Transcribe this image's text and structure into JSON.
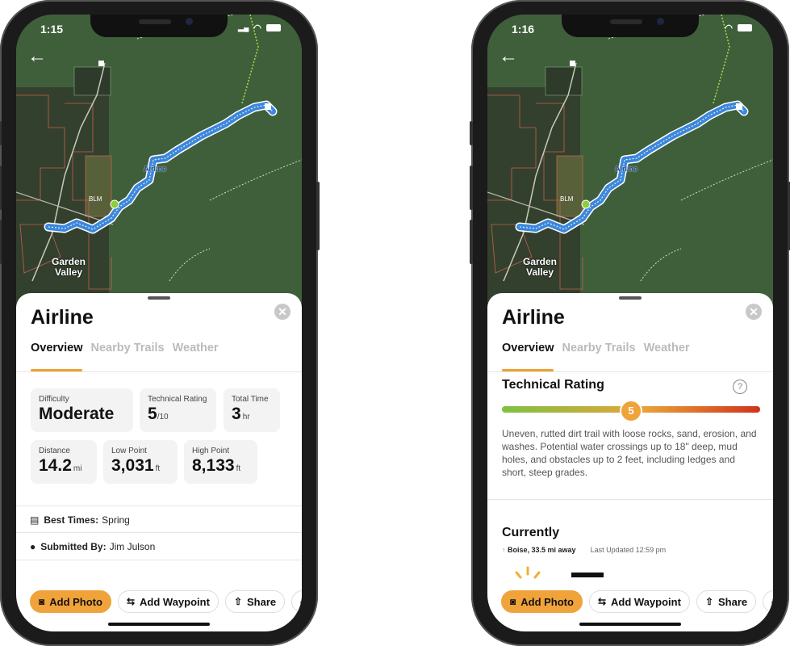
{
  "phones": [
    {
      "status_time": "1:15",
      "trail_name": "Airline",
      "map_labels": {
        "trail": "Airline",
        "area": "BLM",
        "town_line1": "Garden",
        "town_line2": "Valley"
      },
      "tabs": [
        {
          "label": "Overview",
          "active": true
        },
        {
          "label": "Nearby Trails"
        },
        {
          "label": "Weather"
        }
      ],
      "stats": [
        {
          "label": "Difficulty",
          "value": "Moderate",
          "unit": ""
        },
        {
          "label": "Technical Rating",
          "value": "5",
          "unit": "/10"
        },
        {
          "label": "Total Time",
          "value": "3",
          "unit": "hr"
        },
        {
          "label": "Distance",
          "value": "14.2",
          "unit": "mi"
        },
        {
          "label": "Low Point",
          "value": "3,031",
          "unit": "ft"
        },
        {
          "label": "High Point",
          "value": "8,133",
          "unit": "ft"
        }
      ],
      "best_times": {
        "label": "Best Times:",
        "value": "Spring"
      },
      "submitted_by": {
        "label": "Submitted By:",
        "value": "Jim Julson"
      }
    },
    {
      "status_time": "1:16",
      "trail_name": "Airline",
      "map_labels": {
        "trail": "Airline",
        "area": "BLM",
        "town_line1": "Garden",
        "town_line2": "Valley"
      },
      "tabs": [
        {
          "label": "Overview",
          "active": true
        },
        {
          "label": "Nearby Trails"
        },
        {
          "label": "Weather"
        }
      ],
      "technical_rating": {
        "title": "Technical Rating",
        "value": 5,
        "max": 10,
        "description": "Uneven, rutted dirt trail with loose rocks, sand, erosion, and washes. Potential water crossings up to 18\" deep, mud holes, and obstacles up to 2 feet, including ledges and short, steep grades."
      },
      "currently": {
        "title": "Currently",
        "location": "Boise, 33.5 mi away",
        "last_updated": "Last Updated 12:59 pm"
      }
    }
  ],
  "actions": {
    "add_photo": "Add Photo",
    "add_waypoint": "Add Waypoint",
    "share": "Share"
  },
  "colors": {
    "accent": "#f0a33a",
    "route": "#3b86e0",
    "start_marker": "#8ccf3a"
  }
}
